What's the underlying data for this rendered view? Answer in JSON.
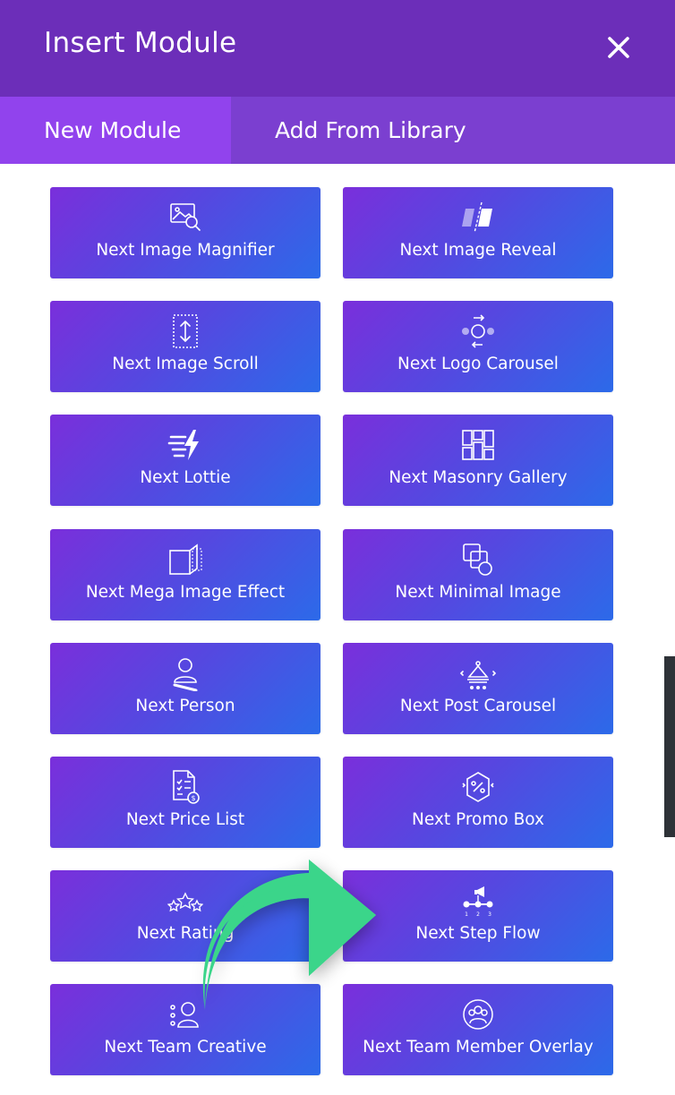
{
  "dialog": {
    "title": "Insert Module",
    "close_icon": "close-icon"
  },
  "tabs": [
    {
      "label": "New Module",
      "active": true
    },
    {
      "label": "Add From Library",
      "active": false
    }
  ],
  "modules": [
    {
      "label": "Next Image Magnifier",
      "icon": "image-magnifier-icon"
    },
    {
      "label": "Next Image Reveal",
      "icon": "image-reveal-icon"
    },
    {
      "label": "Next Image Scroll",
      "icon": "image-scroll-icon"
    },
    {
      "label": "Next Logo Carousel",
      "icon": "logo-carousel-icon"
    },
    {
      "label": "Next Lottie",
      "icon": "lottie-icon"
    },
    {
      "label": "Next Masonry Gallery",
      "icon": "masonry-gallery-icon"
    },
    {
      "label": "Next Mega Image Effect",
      "icon": "mega-image-effect-icon"
    },
    {
      "label": "Next Minimal Image",
      "icon": "minimal-image-icon"
    },
    {
      "label": "Next Person",
      "icon": "person-icon"
    },
    {
      "label": "Next Post Carousel",
      "icon": "post-carousel-icon"
    },
    {
      "label": "Next Price List",
      "icon": "price-list-icon"
    },
    {
      "label": "Next Promo Box",
      "icon": "promo-box-icon"
    },
    {
      "label": "Next Rating",
      "icon": "rating-icon"
    },
    {
      "label": "Next Step Flow",
      "icon": "step-flow-icon"
    },
    {
      "label": "Next Team Creative",
      "icon": "team-creative-icon"
    },
    {
      "label": "Next Team Member Overlay",
      "icon": "team-member-overlay-icon"
    }
  ],
  "colors": {
    "header": "#6c2eb9",
    "tab_active": "#9143ed",
    "tab_bar": "#7b3fd0",
    "tile_start": "#7a2fdb",
    "tile_end": "#2c6ae9",
    "arrow": "#3bd58a"
  }
}
